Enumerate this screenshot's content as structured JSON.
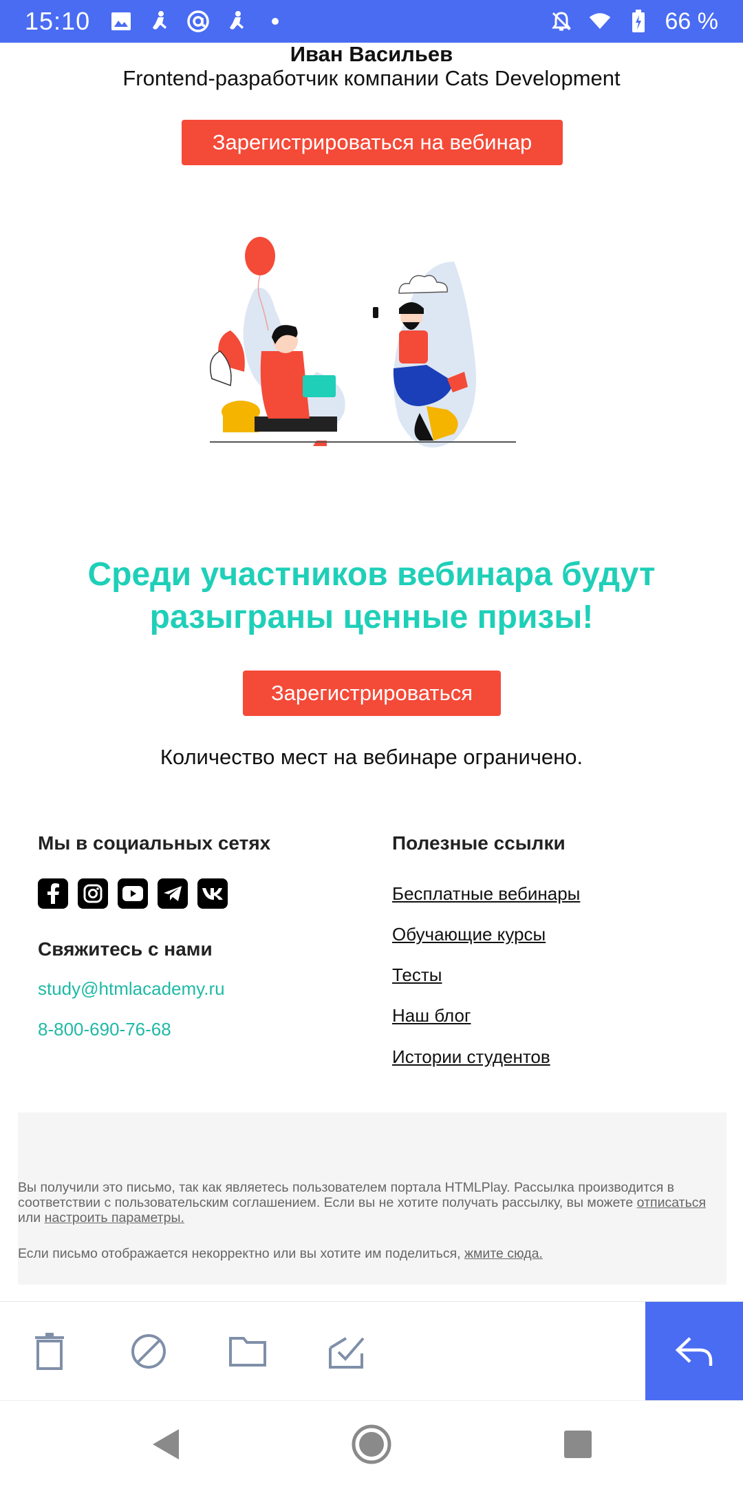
{
  "status_bar": {
    "time": "15:10",
    "left_icons": [
      "image-icon",
      "accessibility-icon",
      "at-sign-icon",
      "accessibility-icon",
      "dot-icon"
    ],
    "right_icons": [
      "alarm-off-icon",
      "wifi-icon",
      "battery-icon"
    ],
    "battery": "66 %"
  },
  "email": {
    "author_name": "Иван Васильев",
    "author_role": "Frontend-разработчик компании Cats Development",
    "register_webinar_label": "Зарегистрироваться на вебинар",
    "promo_title": "Среди участников вебинара будут разыграны ценные призы!",
    "register_label": "Зарегистрироваться",
    "limited_note": "Количество мест на вебинаре ограничено.",
    "social": {
      "heading": "Мы в социальных сетях",
      "icons": [
        "facebook-icon",
        "instagram-icon",
        "youtube-icon",
        "telegram-icon",
        "vk-icon"
      ]
    },
    "contact": {
      "heading": "Свяжитесь с нами",
      "email": "study@htmlacademy.ru",
      "phone": "8-800-690-76-68"
    },
    "useful": {
      "heading": "Полезные ссылки",
      "links": [
        "Бесплатные вебинары",
        "Обучающие курсы",
        "Тесты",
        "Наш блог",
        "Истории студентов"
      ]
    },
    "footer": {
      "notice_text": "Вы получили это письмо, так как являетесь пользователем портала HTMLPlay. Рассылка производится в соответствии с пользовательским соглашением. Если вы не хотите получать рассылку, вы можете",
      "unsubscribe_link": "отписаться",
      "or_text": "или",
      "settings_link": "настроить параметры.",
      "display_issue_text": "Если письмо отображается некорректно или вы хотите им поделиться,",
      "click_here_link": "жмите сюда."
    }
  },
  "colors": {
    "accent_blue": "#4a6cf3",
    "button_red": "#f44a38",
    "teal": "#1fcfb8"
  },
  "action_bar": {
    "icons": [
      "trash-icon",
      "block-icon",
      "folder-icon",
      "mark-done-icon",
      "reply-icon"
    ]
  },
  "nav_bar": {
    "icons": [
      "back-icon",
      "home-icon",
      "recents-icon"
    ]
  }
}
